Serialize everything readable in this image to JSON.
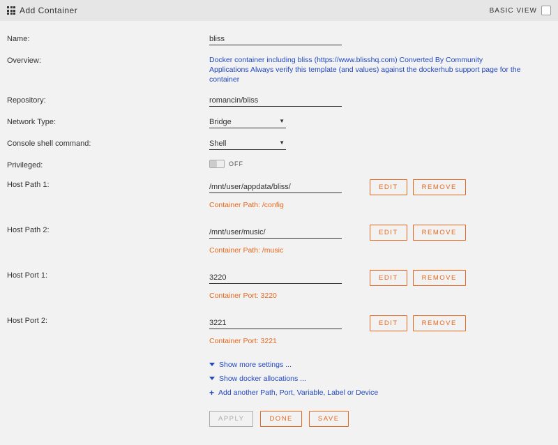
{
  "header": {
    "title": "Add Container",
    "view_label": "BASIC VIEW"
  },
  "labels": {
    "name": "Name:",
    "overview": "Overview:",
    "repository": "Repository:",
    "network_type": "Network Type:",
    "console_shell": "Console shell command:",
    "privileged": "Privileged:",
    "host_path_1": "Host Path 1:",
    "host_path_2": "Host Path 2:",
    "host_port_1": "Host Port 1:",
    "host_port_2": "Host Port 2:"
  },
  "values": {
    "name": "bliss",
    "repository": "romancin/bliss",
    "network_type": "Bridge",
    "console_shell": "Shell",
    "privileged": "OFF",
    "path1": "/mnt/user/appdata/bliss/",
    "path1_hint": "Container Path: /config",
    "path2": "/mnt/user/music/",
    "path2_hint": "Container Path: /music",
    "port1": "3220",
    "port1_hint": "Container Port: 3220",
    "port2": "3221",
    "port2_hint": "Container Port: 3221"
  },
  "overview": "Docker container including bliss (https://www.blisshq.com) Converted By Community Applications Always verify this template (and values) against the dockerhub support page for the container",
  "buttons": {
    "edit": "EDIT",
    "remove": "REMOVE",
    "apply": "APPLY",
    "done": "DONE",
    "save": "SAVE"
  },
  "links": {
    "show_more": "Show more settings ...",
    "show_docker": "Show docker allocations ...",
    "add_another": "Add another Path, Port, Variable, Label or Device"
  }
}
